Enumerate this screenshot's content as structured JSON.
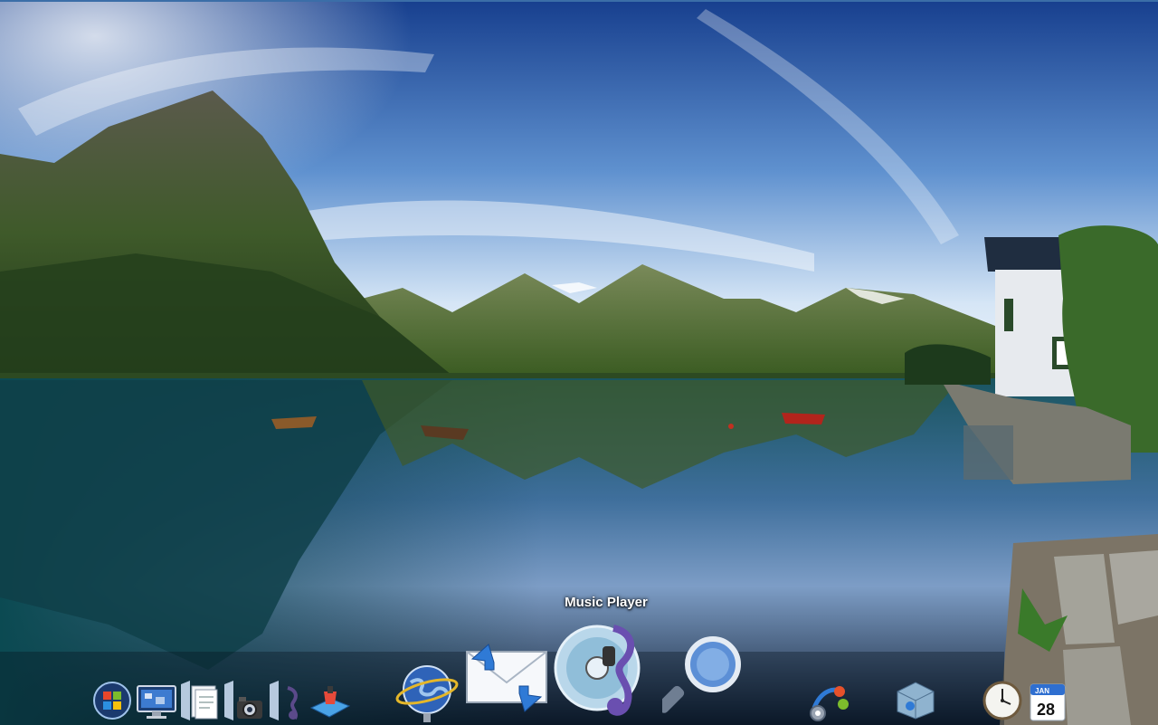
{
  "dock": {
    "hover_label": "Music Player",
    "items": [
      {
        "icon": "windows-start-icon"
      },
      {
        "icon": "desktop-monitor-icon"
      },
      {
        "icon": "documents-stack-icon"
      },
      {
        "icon": "camera-stack-icon"
      },
      {
        "icon": "music-stack-icon"
      },
      {
        "icon": "paint-app-icon"
      },
      {
        "icon": "globe-browser-icon"
      },
      {
        "icon": "mail-sync-icon"
      },
      {
        "icon": "music-player-icon"
      },
      {
        "icon": "search-magnifier-icon"
      },
      {
        "icon": "settings-gears-icon"
      },
      {
        "icon": "cube-app-icon"
      },
      {
        "icon": "clock-icon"
      },
      {
        "icon": "calendar-icon"
      }
    ],
    "calendar": {
      "month": "JAN",
      "day": "28"
    }
  },
  "colors": {
    "sky_top": "#1d4f9e",
    "sky_horizon": "#c6dcf2",
    "water": "#0d3a46",
    "mountain": "#2f4a22"
  }
}
